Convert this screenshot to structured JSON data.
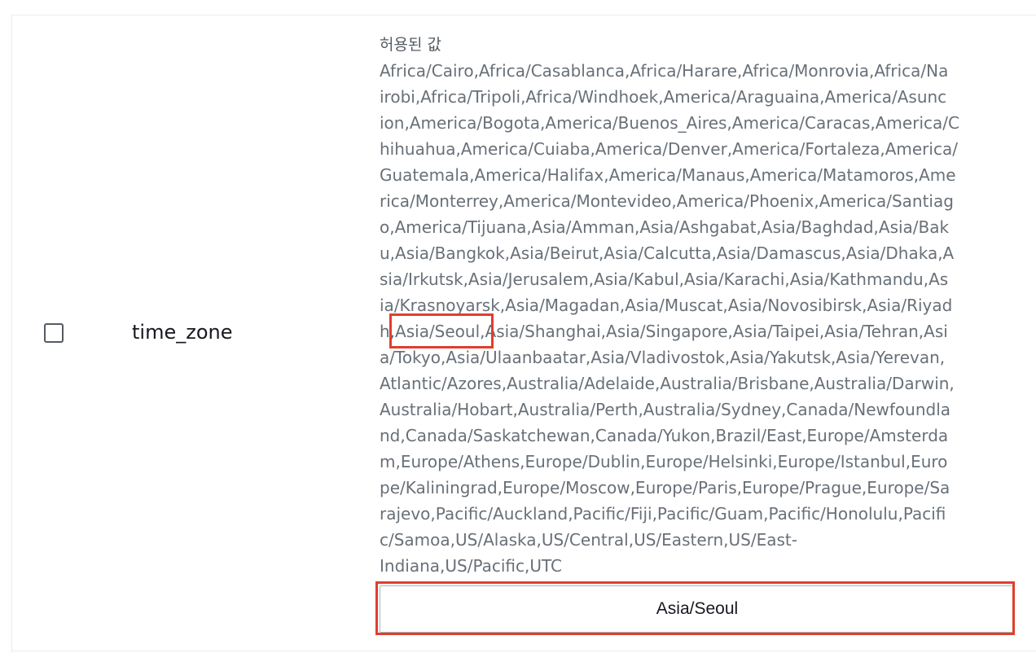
{
  "row": {
    "parameter_name": "time_zone",
    "allowed_values_label": "허용된 값",
    "allowed_values_lines": [
      "Africa/Cairo,Africa/Casablanca,Africa/Harare,Africa/Monrovia,Africa/Na",
      "irobi,Africa/Tripoli,Africa/Windhoek,America/Araguaina,America/Asunc",
      "ion,America/Bogota,America/Buenos_Aires,America/Caracas,America/C",
      "hihuahua,America/Cuiaba,America/Denver,America/Fortaleza,America/",
      "Guatemala,America/Halifax,America/Manaus,America/Matamoros,Ame",
      "rica/Monterrey,America/Montevideo,America/Phoenix,America/Santiag",
      "o,America/Tijuana,Asia/Amman,Asia/Ashgabat,Asia/Baghdad,Asia/Bak",
      "u,Asia/Bangkok,Asia/Beirut,Asia/Calcutta,Asia/Damascus,Asia/Dhaka,A",
      "sia/Irkutsk,Asia/Jerusalem,Asia/Kabul,Asia/Karachi,Asia/Kathmandu,As",
      "ia/Krasnoyarsk,Asia/Magadan,Asia/Muscat,Asia/Novosibirsk,Asia/Riyad",
      "h,Asia/Seoul,Asia/Shanghai,Asia/Singapore,Asia/Taipei,Asia/Tehran,Asi",
      "a/Tokyo,Asia/Ulaanbaatar,Asia/Vladivostok,Asia/Yakutsk,Asia/Yerevan,",
      "Atlantic/Azores,Australia/Adelaide,Australia/Brisbane,Australia/Darwin,",
      "Australia/Hobart,Australia/Perth,Australia/Sydney,Canada/Newfoundla",
      "nd,Canada/Saskatchewan,Canada/Yukon,Brazil/East,Europe/Amsterda",
      "m,Europe/Athens,Europe/Dublin,Europe/Helsinki,Europe/Istanbul,Euro",
      "pe/Kaliningrad,Europe/Moscow,Europe/Paris,Europe/Prague,Europe/Sa",
      "rajevo,Pacific/Auckland,Pacific/Fiji,Pacific/Guam,Pacific/Honolulu,Pacifi",
      "c/Samoa,US/Alaska,US/Central,US/Eastern,US/East-",
      "Indiana,US/Pacific,UTC"
    ],
    "value_input": "Asia/Seoul",
    "checkbox_checked": false
  },
  "colors": {
    "highlight": "#e03e2d",
    "muted_text": "#687078",
    "label_text": "#545b64"
  }
}
